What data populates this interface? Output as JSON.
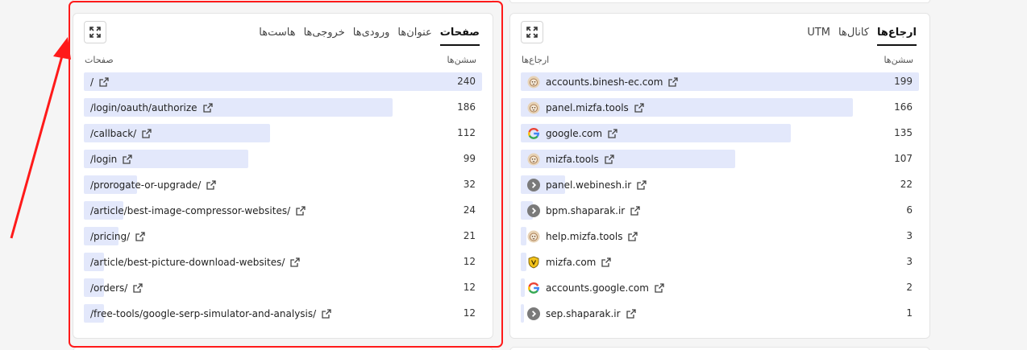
{
  "pages_panel": {
    "tabs": [
      {
        "label": "صفحات",
        "active": true
      },
      {
        "label": "عنوان‌ها",
        "active": false
      },
      {
        "label": "ورودی‌ها",
        "active": false
      },
      {
        "label": "خروجی‌ها",
        "active": false
      },
      {
        "label": "هاست‌ها",
        "active": false
      }
    ],
    "col_label": "صفحات",
    "col_value": "سشن‌ها",
    "rows": [
      {
        "label": "/",
        "value": 240
      },
      {
        "label": "/login/oauth/authorize",
        "value": 186
      },
      {
        "label": "/callback/",
        "value": 112
      },
      {
        "label": "/login",
        "value": 99
      },
      {
        "label": "/prorogate-or-upgrade/",
        "value": 32
      },
      {
        "label": "/article/best-image-compressor-websites/",
        "value": 24
      },
      {
        "label": "/pricing/",
        "value": 21
      },
      {
        "label": "/article/best-picture-download-websites/",
        "value": 12
      },
      {
        "label": "/orders/",
        "value": 12
      },
      {
        "label": "/free-tools/google-serp-simulator-and-analysis/",
        "value": 12
      }
    ]
  },
  "referrers_panel": {
    "tabs": [
      {
        "label": "ارجاع‌ها",
        "active": true
      },
      {
        "label": "کانال‌ها",
        "active": false
      },
      {
        "label": "UTM",
        "active": false
      }
    ],
    "col_label": "ارجاع‌ها",
    "col_value": "سشن‌ها",
    "rows": [
      {
        "label": "accounts.binesh-ec.com",
        "value": 199,
        "icon": "lion-icon"
      },
      {
        "label": "panel.mizfa.tools",
        "value": 166,
        "icon": "lion-icon"
      },
      {
        "label": "google.com",
        "value": 135,
        "icon": "google-icon"
      },
      {
        "label": "mizfa.tools",
        "value": 107,
        "icon": "lion-icon"
      },
      {
        "label": "panel.webinesh.ir",
        "value": 22,
        "icon": "chevron-circle-icon"
      },
      {
        "label": "bpm.shaparak.ir",
        "value": 6,
        "icon": "chevron-circle-icon"
      },
      {
        "label": "help.mizfa.tools",
        "value": 3,
        "icon": "lion-icon"
      },
      {
        "label": "mizfa.com",
        "value": 3,
        "icon": "shield-icon"
      },
      {
        "label": "accounts.google.com",
        "value": 2,
        "icon": "google-icon"
      },
      {
        "label": "sep.shaparak.ir",
        "value": 1,
        "icon": "chevron-circle-icon"
      }
    ]
  },
  "colors": {
    "bar": "#e3e8fb",
    "highlight": "#ff1a1a",
    "active_tab": "#111111"
  }
}
